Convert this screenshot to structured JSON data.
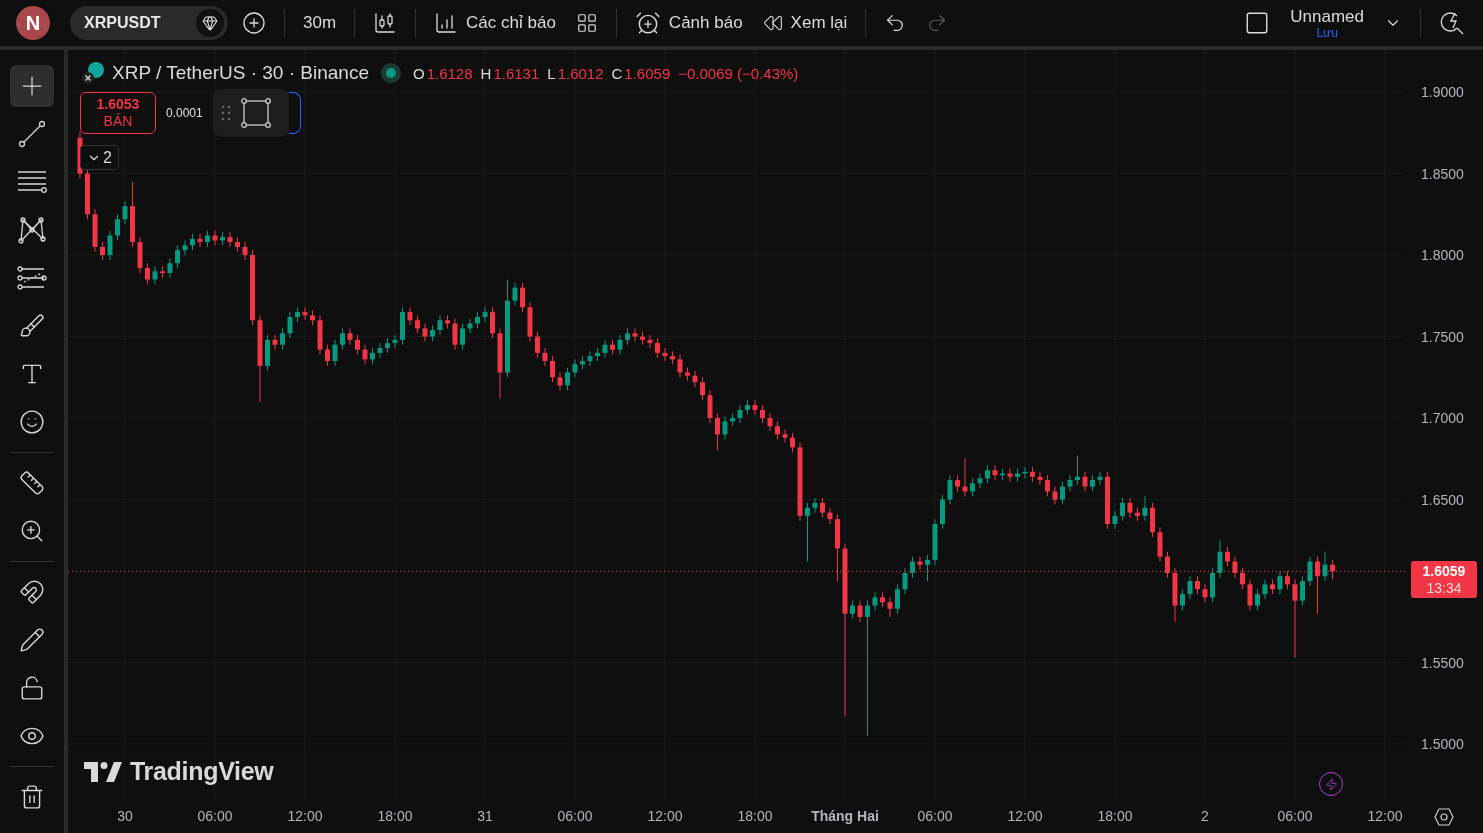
{
  "toolbar": {
    "avatar": "N",
    "symbol": "XRPUSDT",
    "interval": "30m",
    "indicators": "Các chỉ báo",
    "alerts": "Cảnh báo",
    "replay": "Xem lại",
    "redo_disabled": true,
    "layout_name": "Unnamed",
    "save": "Lưu"
  },
  "drawing_tools": [
    {
      "tools": [
        {
          "kind": "crosshair",
          "selected": true
        },
        {
          "kind": "trend-line",
          "selected": false
        },
        {
          "kind": "horizontal-lines",
          "selected": false
        },
        {
          "kind": "pattern",
          "selected": false
        },
        {
          "kind": "fib",
          "selected": false
        },
        {
          "kind": "brush",
          "selected": false
        },
        {
          "kind": "text",
          "selected": false
        },
        {
          "kind": "emoji",
          "selected": false
        }
      ]
    },
    {
      "tools": [
        {
          "kind": "ruler",
          "selected": false
        },
        {
          "kind": "zoom",
          "selected": false
        }
      ]
    },
    {
      "tools": [
        {
          "kind": "magnet",
          "selected": false
        },
        {
          "kind": "draw-lock",
          "selected": false
        },
        {
          "kind": "lock",
          "selected": false
        },
        {
          "kind": "eye",
          "selected": false
        }
      ]
    },
    {
      "tools": [
        {
          "kind": "trash",
          "selected": false
        }
      ]
    }
  ],
  "legend": {
    "title": "XRP / TetherUS · 30 · Binance",
    "market_open": true,
    "falling": true,
    "values": [
      {
        "label": "O",
        "value": "1.6128"
      },
      {
        "label": "H",
        "value": "1.6131"
      },
      {
        "label": "L",
        "value": "1.6012"
      },
      {
        "label": "C",
        "value": "1.6059"
      }
    ],
    "change": "−0.0069 (−0.43%)"
  },
  "order": {
    "sell_price": "1.6053",
    "sell_label": "BÁN",
    "spread": "0.0001"
  },
  "collapse": {
    "count": "2"
  },
  "watermark": "TradingView",
  "chart": {
    "countdown": "13:34",
    "tick_styles": [
      {
        "bold": false
      },
      {
        "bold": false
      },
      {
        "bold": false
      },
      {
        "bold": false
      },
      {
        "bold": false
      },
      {
        "bold": false
      },
      {
        "bold": false
      },
      {
        "bold": false
      },
      {
        "bold": true
      },
      {
        "bold": false
      },
      {
        "bold": false
      },
      {
        "bold": false
      },
      {
        "bold": false
      },
      {
        "bold": false
      },
      {
        "bold": false
      }
    ],
    "chart_data": {
      "type": "candlestick",
      "grid": true,
      "ylim": [
        1.4657,
        1.9258
      ],
      "categories": [
        null,
        null,
        null,
        null,
        null,
        null,
        "30",
        null,
        null,
        null,
        null,
        null,
        null,
        null,
        null,
        null,
        null,
        null,
        "06:00",
        null,
        null,
        null,
        null,
        null,
        null,
        null,
        null,
        null,
        null,
        null,
        "12:00",
        null,
        null,
        null,
        null,
        null,
        null,
        null,
        null,
        null,
        null,
        null,
        "18:00",
        null,
        null,
        null,
        null,
        null,
        null,
        null,
        null,
        null,
        null,
        null,
        "31",
        null,
        null,
        null,
        null,
        null,
        null,
        null,
        null,
        null,
        null,
        null,
        "06:00",
        null,
        null,
        null,
        null,
        null,
        null,
        null,
        null,
        null,
        null,
        null,
        "12:00",
        null,
        null,
        null,
        null,
        null,
        null,
        null,
        null,
        null,
        null,
        null,
        "18:00",
        null,
        null,
        null,
        null,
        null,
        null,
        null,
        null,
        null,
        null,
        null,
        "Tháng Hai",
        null,
        null,
        null,
        null,
        null,
        null,
        null,
        null,
        null,
        null,
        null,
        "06:00",
        null,
        null,
        null,
        null,
        null,
        null,
        null,
        null,
        null,
        null,
        null,
        "12:00",
        null,
        null,
        null,
        null,
        null,
        null,
        null,
        null,
        null,
        null,
        null,
        "18:00",
        null,
        null,
        null,
        null,
        null,
        null,
        null,
        null,
        null,
        null,
        null,
        "2",
        null,
        null,
        null,
        null,
        null,
        null,
        null,
        null,
        null,
        null,
        null,
        "06:00",
        null,
        null,
        null,
        null,
        null,
        null,
        null,
        null,
        null,
        null,
        null,
        "12:00"
      ],
      "ohlc": [
        [
          1.872,
          1.876,
          1.847,
          1.85
        ],
        [
          1.85,
          1.853,
          1.822,
          1.825
        ],
        [
          1.825,
          1.828,
          1.802,
          1.805
        ],
        [
          1.805,
          1.808,
          1.797,
          1.8
        ],
        [
          1.8,
          1.815,
          1.797,
          1.812
        ],
        [
          1.812,
          1.825,
          1.809,
          1.822
        ],
        [
          1.822,
          1.833,
          1.819,
          1.83
        ],
        [
          1.83,
          1.845,
          1.805,
          1.808
        ],
        [
          1.808,
          1.811,
          1.789,
          1.792
        ],
        [
          1.792,
          1.795,
          1.782,
          1.785
        ],
        [
          1.785,
          1.793,
          1.782,
          1.79
        ],
        [
          1.79,
          1.793,
          1.786,
          1.789
        ],
        [
          1.789,
          1.798,
          1.786,
          1.795
        ],
        [
          1.795,
          1.806,
          1.792,
          1.803
        ],
        [
          1.803,
          1.809,
          1.8,
          1.806
        ],
        [
          1.806,
          1.813,
          1.803,
          1.81
        ],
        [
          1.81,
          1.813,
          1.805,
          1.808
        ],
        [
          1.808,
          1.815,
          1.805,
          1.812
        ],
        [
          1.812,
          1.815,
          1.806,
          1.809
        ],
        [
          1.809,
          1.814,
          1.806,
          1.811
        ],
        [
          1.811,
          1.814,
          1.805,
          1.808
        ],
        [
          1.808,
          1.811,
          1.802,
          1.805
        ],
        [
          1.805,
          1.808,
          1.797,
          1.8
        ],
        [
          1.8,
          1.803,
          1.757,
          1.76
        ],
        [
          1.76,
          1.763,
          1.71,
          1.732
        ],
        [
          1.732,
          1.751,
          1.729,
          1.748
        ],
        [
          1.748,
          1.751,
          1.742,
          1.745
        ],
        [
          1.745,
          1.755,
          1.742,
          1.752
        ],
        [
          1.752,
          1.765,
          1.749,
          1.762
        ],
        [
          1.762,
          1.768,
          1.759,
          1.765
        ],
        [
          1.765,
          1.768,
          1.76,
          1.763
        ],
        [
          1.763,
          1.766,
          1.757,
          1.76
        ],
        [
          1.76,
          1.763,
          1.739,
          1.742
        ],
        [
          1.742,
          1.745,
          1.732,
          1.735
        ],
        [
          1.735,
          1.748,
          1.732,
          1.745
        ],
        [
          1.745,
          1.755,
          1.742,
          1.752
        ],
        [
          1.752,
          1.755,
          1.745,
          1.748
        ],
        [
          1.748,
          1.751,
          1.739,
          1.742
        ],
        [
          1.742,
          1.745,
          1.733,
          1.736
        ],
        [
          1.736,
          1.743,
          1.733,
          1.74
        ],
        [
          1.74,
          1.746,
          1.737,
          1.743
        ],
        [
          1.743,
          1.749,
          1.74,
          1.746
        ],
        [
          1.746,
          1.751,
          1.743,
          1.748
        ],
        [
          1.748,
          1.768,
          1.745,
          1.765
        ],
        [
          1.765,
          1.768,
          1.757,
          1.76
        ],
        [
          1.76,
          1.763,
          1.752,
          1.755
        ],
        [
          1.755,
          1.758,
          1.747,
          1.75
        ],
        [
          1.75,
          1.757,
          1.747,
          1.754
        ],
        [
          1.754,
          1.763,
          1.751,
          1.76
        ],
        [
          1.76,
          1.763,
          1.755,
          1.758
        ],
        [
          1.758,
          1.761,
          1.742,
          1.745
        ],
        [
          1.745,
          1.758,
          1.742,
          1.755
        ],
        [
          1.755,
          1.761,
          1.752,
          1.758
        ],
        [
          1.758,
          1.765,
          1.755,
          1.762
        ],
        [
          1.762,
          1.768,
          1.759,
          1.765
        ],
        [
          1.765,
          1.768,
          1.749,
          1.752
        ],
        [
          1.752,
          1.755,
          1.712,
          1.728
        ],
        [
          1.728,
          1.785,
          1.725,
          1.772
        ],
        [
          1.772,
          1.783,
          1.769,
          1.78
        ],
        [
          1.78,
          1.783,
          1.765,
          1.768
        ],
        [
          1.768,
          1.771,
          1.747,
          1.75
        ],
        [
          1.75,
          1.753,
          1.737,
          1.74
        ],
        [
          1.74,
          1.743,
          1.732,
          1.735
        ],
        [
          1.735,
          1.738,
          1.722,
          1.725
        ],
        [
          1.725,
          1.728,
          1.717,
          1.72
        ],
        [
          1.72,
          1.731,
          1.717,
          1.728
        ],
        [
          1.728,
          1.736,
          1.725,
          1.733
        ],
        [
          1.733,
          1.738,
          1.73,
          1.735
        ],
        [
          1.735,
          1.741,
          1.732,
          1.738
        ],
        [
          1.738,
          1.743,
          1.735,
          1.74
        ],
        [
          1.74,
          1.748,
          1.737,
          1.745
        ],
        [
          1.745,
          1.748,
          1.739,
          1.742
        ],
        [
          1.742,
          1.751,
          1.739,
          1.748
        ],
        [
          1.748,
          1.755,
          1.745,
          1.752
        ],
        [
          1.752,
          1.755,
          1.747,
          1.75
        ],
        [
          1.75,
          1.753,
          1.745,
          1.748
        ],
        [
          1.748,
          1.751,
          1.743,
          1.746
        ],
        [
          1.746,
          1.749,
          1.737,
          1.74
        ],
        [
          1.74,
          1.743,
          1.735,
          1.738
        ],
        [
          1.738,
          1.741,
          1.733,
          1.736
        ],
        [
          1.736,
          1.739,
          1.725,
          1.728
        ],
        [
          1.728,
          1.731,
          1.723,
          1.726
        ],
        [
          1.726,
          1.729,
          1.719,
          1.722
        ],
        [
          1.722,
          1.725,
          1.711,
          1.714
        ],
        [
          1.714,
          1.717,
          1.697,
          1.7
        ],
        [
          1.7,
          1.703,
          1.68,
          1.69
        ],
        [
          1.69,
          1.701,
          1.687,
          1.698
        ],
        [
          1.698,
          1.703,
          1.695,
          1.7
        ],
        [
          1.7,
          1.708,
          1.697,
          1.705
        ],
        [
          1.705,
          1.711,
          1.702,
          1.708
        ],
        [
          1.708,
          1.711,
          1.702,
          1.705
        ],
        [
          1.705,
          1.708,
          1.697,
          1.7
        ],
        [
          1.7,
          1.703,
          1.692,
          1.695
        ],
        [
          1.695,
          1.698,
          1.687,
          1.69
        ],
        [
          1.69,
          1.693,
          1.685,
          1.688
        ],
        [
          1.688,
          1.691,
          1.679,
          1.682
        ],
        [
          1.682,
          1.685,
          1.637,
          1.64
        ],
        [
          1.64,
          1.648,
          1.612,
          1.645
        ],
        [
          1.645,
          1.651,
          1.642,
          1.648
        ],
        [
          1.648,
          1.651,
          1.639,
          1.642
        ],
        [
          1.642,
          1.645,
          1.635,
          1.638
        ],
        [
          1.638,
          1.641,
          1.6,
          1.62
        ],
        [
          1.62,
          1.623,
          1.517,
          1.58
        ],
        [
          1.58,
          1.588,
          1.577,
          1.585
        ],
        [
          1.585,
          1.588,
          1.575,
          1.578
        ],
        [
          1.578,
          1.588,
          1.505,
          1.585
        ],
        [
          1.585,
          1.593,
          1.582,
          1.59
        ],
        [
          1.59,
          1.593,
          1.584,
          1.587
        ],
        [
          1.587,
          1.59,
          1.578,
          1.583
        ],
        [
          1.583,
          1.598,
          1.58,
          1.595
        ],
        [
          1.595,
          1.608,
          1.592,
          1.605
        ],
        [
          1.605,
          1.615,
          1.602,
          1.612
        ],
        [
          1.612,
          1.615,
          1.607,
          1.61
        ],
        [
          1.61,
          1.616,
          1.6,
          1.613
        ],
        [
          1.613,
          1.638,
          1.61,
          1.635
        ],
        [
          1.635,
          1.653,
          1.632,
          1.65
        ],
        [
          1.65,
          1.665,
          1.647,
          1.662
        ],
        [
          1.662,
          1.665,
          1.655,
          1.658
        ],
        [
          1.658,
          1.675,
          1.652,
          1.655
        ],
        [
          1.655,
          1.663,
          1.652,
          1.66
        ],
        [
          1.66,
          1.666,
          1.657,
          1.663
        ],
        [
          1.663,
          1.671,
          1.66,
          1.668
        ],
        [
          1.668,
          1.671,
          1.662,
          1.665
        ],
        [
          1.665,
          1.669,
          1.662,
          1.666
        ],
        [
          1.666,
          1.669,
          1.661,
          1.664
        ],
        [
          1.664,
          1.669,
          1.661,
          1.666
        ],
        [
          1.666,
          1.67,
          1.663,
          1.667
        ],
        [
          1.667,
          1.67,
          1.661,
          1.664
        ],
        [
          1.664,
          1.667,
          1.659,
          1.662
        ],
        [
          1.662,
          1.665,
          1.652,
          1.655
        ],
        [
          1.655,
          1.658,
          1.647,
          1.65
        ],
        [
          1.65,
          1.661,
          1.647,
          1.658
        ],
        [
          1.658,
          1.665,
          1.655,
          1.662
        ],
        [
          1.662,
          1.677,
          1.659,
          1.664
        ],
        [
          1.664,
          1.667,
          1.655,
          1.658
        ],
        [
          1.658,
          1.665,
          1.655,
          1.662
        ],
        [
          1.662,
          1.667,
          1.659,
          1.664
        ],
        [
          1.664,
          1.667,
          1.632,
          1.635
        ],
        [
          1.635,
          1.643,
          1.632,
          1.64
        ],
        [
          1.64,
          1.651,
          1.637,
          1.648
        ],
        [
          1.648,
          1.651,
          1.639,
          1.642
        ],
        [
          1.642,
          1.645,
          1.637,
          1.64
        ],
        [
          1.64,
          1.652,
          1.637,
          1.645
        ],
        [
          1.645,
          1.648,
          1.627,
          1.63
        ],
        [
          1.63,
          1.633,
          1.612,
          1.615
        ],
        [
          1.615,
          1.618,
          1.602,
          1.605
        ],
        [
          1.605,
          1.608,
          1.575,
          1.585
        ],
        [
          1.585,
          1.595,
          1.582,
          1.592
        ],
        [
          1.592,
          1.603,
          1.589,
          1.6
        ],
        [
          1.6,
          1.603,
          1.592,
          1.595
        ],
        [
          1.595,
          1.598,
          1.587,
          1.59
        ],
        [
          1.59,
          1.608,
          1.587,
          1.605
        ],
        [
          1.605,
          1.625,
          1.602,
          1.618
        ],
        [
          1.618,
          1.621,
          1.609,
          1.612
        ],
        [
          1.612,
          1.615,
          1.602,
          1.605
        ],
        [
          1.605,
          1.608,
          1.595,
          1.598
        ],
        [
          1.598,
          1.601,
          1.582,
          1.585
        ],
        [
          1.585,
          1.595,
          1.582,
          1.592
        ],
        [
          1.592,
          1.601,
          1.589,
          1.598
        ],
        [
          1.598,
          1.601,
          1.592,
          1.595
        ],
        [
          1.595,
          1.606,
          1.592,
          1.603
        ],
        [
          1.603,
          1.606,
          1.595,
          1.598
        ],
        [
          1.598,
          1.601,
          1.553,
          1.588
        ],
        [
          1.588,
          1.603,
          1.585,
          1.6
        ],
        [
          1.6,
          1.615,
          1.597,
          1.612
        ],
        [
          1.612,
          1.615,
          1.58,
          1.603
        ],
        [
          1.603,
          1.618,
          1.6,
          1.61
        ],
        [
          1.61,
          1.613,
          1.601,
          1.6059
        ],
        null,
        null,
        null,
        null,
        null,
        null,
        null
      ],
      "yticks": [
        {
          "value": 1.9,
          "label": "1.9000"
        },
        {
          "value": 1.85,
          "label": "1.8500"
        },
        {
          "value": 1.8,
          "label": "1.8000"
        },
        {
          "value": 1.75,
          "label": "1.7500"
        },
        {
          "value": 1.7,
          "label": "1.7000"
        },
        {
          "value": 1.65,
          "label": "1.6500"
        },
        {
          "value": 1.55,
          "label": "1.5500"
        },
        {
          "value": 1.5,
          "label": "1.5000"
        }
      ],
      "ref_lines": [
        {
          "axis": "y",
          "value": 1.6059,
          "label": "1.6059"
        }
      ]
    }
  }
}
